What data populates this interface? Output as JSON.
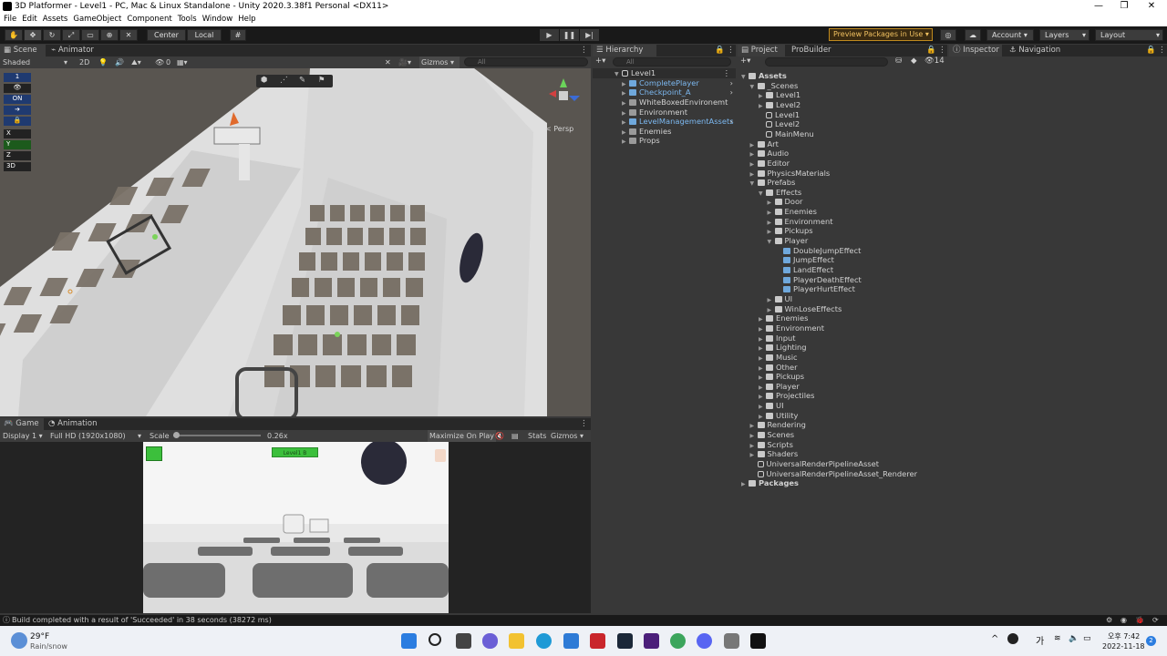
{
  "window": {
    "title": "3D Platformer - Level1 - PC, Mac & Linux Standalone - Unity 2020.3.38f1 Personal <DX11>",
    "controls": [
      "—",
      "❐",
      "✕"
    ]
  },
  "menu": [
    "File",
    "Edit",
    "Assets",
    "GameObject",
    "Component",
    "Tools",
    "Window",
    "Help"
  ],
  "toolbar": {
    "pivot": "Center",
    "space": "Local",
    "preview_packages": "Preview Packages in Use ▾",
    "account": "Account",
    "layers": "Layers",
    "layout": "Layout"
  },
  "scene": {
    "tabs": [
      "Scene",
      "Animator"
    ],
    "shading": "Shaded",
    "mode2d": "2D",
    "gizmos": "Gizmos",
    "search_placeholder": "All",
    "hidden_count": "0",
    "persp_label": "< Persp",
    "layer_panel": [
      "1",
      "ON",
      "X",
      "Y",
      "Z",
      "3D"
    ]
  },
  "game": {
    "tabs": [
      "Game",
      "Animation"
    ],
    "display": "Display 1",
    "resolution": "Full HD (1920x1080)",
    "scale_label": "Scale",
    "scale_value": "0.26x",
    "maximize": "Maximize On Play",
    "stats": "Stats",
    "gizmos": "Gizmos",
    "hud_label": "Level1 B"
  },
  "hierarchy": {
    "tab": "Hierarchy",
    "search_placeholder": "All",
    "root": "Level1",
    "items": [
      {
        "label": "CompletePlayer",
        "prefab": true,
        "arrow": true
      },
      {
        "label": "Checkpoint_A",
        "prefab": true,
        "arrow": true
      },
      {
        "label": "WhiteBoxedEnvironemt",
        "prefab": false,
        "arrow": false
      },
      {
        "label": "Environment",
        "prefab": false,
        "arrow": false
      },
      {
        "label": "LevelManagementAssets",
        "prefab": true,
        "arrow": true
      },
      {
        "label": "Enemies",
        "prefab": false,
        "arrow": false
      },
      {
        "label": "Props",
        "prefab": false,
        "arrow": false
      }
    ]
  },
  "project": {
    "tabs": [
      "Project",
      "ProBuilder"
    ],
    "hidden_count": "14",
    "tree": [
      {
        "label": "Assets",
        "depth": 0,
        "type": "folder",
        "open": true,
        "bold": true
      },
      {
        "label": "_Scenes",
        "depth": 1,
        "type": "folder",
        "open": true
      },
      {
        "label": "Level1",
        "depth": 2,
        "type": "folder",
        "open": false
      },
      {
        "label": "Level2",
        "depth": 2,
        "type": "folder",
        "open": false
      },
      {
        "label": "Level1",
        "depth": 2,
        "type": "scene"
      },
      {
        "label": "Level2",
        "depth": 2,
        "type": "scene"
      },
      {
        "label": "MainMenu",
        "depth": 2,
        "type": "scene"
      },
      {
        "label": "Art",
        "depth": 1,
        "type": "folder",
        "open": false
      },
      {
        "label": "Audio",
        "depth": 1,
        "type": "folder",
        "open": false
      },
      {
        "label": "Editor",
        "depth": 1,
        "type": "folder",
        "open": false
      },
      {
        "label": "PhysicsMaterials",
        "depth": 1,
        "type": "folder",
        "open": false
      },
      {
        "label": "Prefabs",
        "depth": 1,
        "type": "folder",
        "open": true
      },
      {
        "label": "Effects",
        "depth": 2,
        "type": "folder",
        "open": true
      },
      {
        "label": "Door",
        "depth": 3,
        "type": "folder",
        "open": false
      },
      {
        "label": "Enemies",
        "depth": 3,
        "type": "folder",
        "open": false
      },
      {
        "label": "Environment",
        "depth": 3,
        "type": "folder",
        "open": false
      },
      {
        "label": "Pickups",
        "depth": 3,
        "type": "folder",
        "open": false
      },
      {
        "label": "Player",
        "depth": 3,
        "type": "folder",
        "open": true
      },
      {
        "label": "DoubleJumpEffect",
        "depth": 4,
        "type": "prefab"
      },
      {
        "label": "JumpEffect",
        "depth": 4,
        "type": "prefab"
      },
      {
        "label": "LandEffect",
        "depth": 4,
        "type": "prefab"
      },
      {
        "label": "PlayerDeathEffect",
        "depth": 4,
        "type": "prefab"
      },
      {
        "label": "PlayerHurtEffect",
        "depth": 4,
        "type": "prefab"
      },
      {
        "label": "UI",
        "depth": 3,
        "type": "folder",
        "open": false
      },
      {
        "label": "WinLoseEffects",
        "depth": 3,
        "type": "folder",
        "open": false
      },
      {
        "label": "Enemies",
        "depth": 2,
        "type": "folder",
        "open": false
      },
      {
        "label": "Environment",
        "depth": 2,
        "type": "folder",
        "open": false
      },
      {
        "label": "Input",
        "depth": 2,
        "type": "folder",
        "open": false
      },
      {
        "label": "Lighting",
        "depth": 2,
        "type": "folder",
        "open": false
      },
      {
        "label": "Music",
        "depth": 2,
        "type": "folder",
        "open": false
      },
      {
        "label": "Other",
        "depth": 2,
        "type": "folder",
        "open": false
      },
      {
        "label": "Pickups",
        "depth": 2,
        "type": "folder",
        "open": false
      },
      {
        "label": "Player",
        "depth": 2,
        "type": "folder",
        "open": false
      },
      {
        "label": "Projectiles",
        "depth": 2,
        "type": "folder",
        "open": false
      },
      {
        "label": "UI",
        "depth": 2,
        "type": "folder",
        "open": false
      },
      {
        "label": "Utility",
        "depth": 2,
        "type": "folder",
        "open": false
      },
      {
        "label": "Rendering",
        "depth": 1,
        "type": "folder",
        "open": false
      },
      {
        "label": "Scenes",
        "depth": 1,
        "type": "folder",
        "open": false
      },
      {
        "label": "Scripts",
        "depth": 1,
        "type": "folder",
        "open": false
      },
      {
        "label": "Shaders",
        "depth": 1,
        "type": "folder",
        "open": false
      },
      {
        "label": "UniversalRenderPipelineAsset",
        "depth": 1,
        "type": "asset"
      },
      {
        "label": "UniversalRenderPipelineAsset_Renderer",
        "depth": 1,
        "type": "asset"
      },
      {
        "label": "Packages",
        "depth": 0,
        "type": "folder",
        "open": false,
        "bold": true
      }
    ]
  },
  "inspector": {
    "tabs": [
      "Inspector",
      "Navigation"
    ]
  },
  "status": {
    "message": "Build completed with a result of 'Succeeded' in 38 seconds (38272 ms)"
  },
  "taskbar": {
    "weather_temp": "29°F",
    "weather_desc": "Rain/snow",
    "ime": "가",
    "time_prefix": "오후",
    "time": "7:42",
    "date": "2022-11-18",
    "notification_count": "2"
  },
  "colors": {
    "accent_blue": "#7cb8f0",
    "preview_border": "#c08a1e",
    "hud_green": "#3cbf3c"
  }
}
